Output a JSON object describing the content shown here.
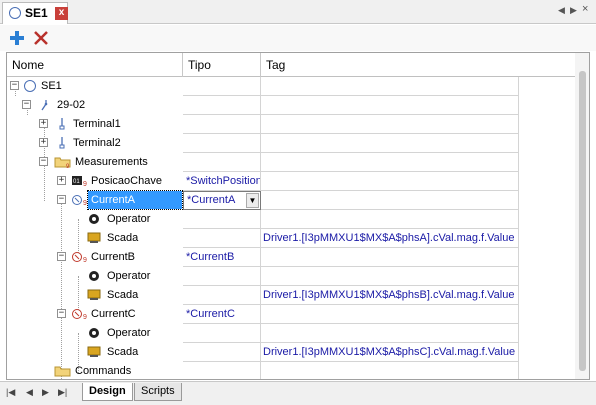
{
  "document_tab": {
    "title": "SE1",
    "close": "x"
  },
  "tab_nav": {
    "left": "◀",
    "right": "▶",
    "close": "×"
  },
  "toolbar": {
    "add": "+",
    "delete": "✕"
  },
  "columns": {
    "name": "Nome",
    "type": "Tipo",
    "tag": "Tag"
  },
  "rows": [
    {
      "label": "SE1",
      "type": "",
      "tag": "",
      "icon": "circle-icon",
      "expander": "−"
    },
    {
      "label": "29-02",
      "type": "",
      "tag": "",
      "icon": "bay-icon",
      "expander": "−"
    },
    {
      "label": "Terminal1",
      "type": "",
      "tag": "",
      "icon": "terminal-icon",
      "expander": "+"
    },
    {
      "label": "Terminal2",
      "type": "",
      "tag": "",
      "icon": "terminal-icon",
      "expander": "+"
    },
    {
      "label": "Measurements",
      "type": "",
      "tag": "",
      "icon": "folder-icon",
      "expander": "−"
    },
    {
      "label": "PosicaoChave",
      "type": "*SwitchPosition",
      "tag": "",
      "icon": "switch-position-icon",
      "expander": "+"
    },
    {
      "label": "CurrentA",
      "type": "*CurrentA",
      "tag": "",
      "icon": "current-icon",
      "expander": "−"
    },
    {
      "label": "Operator",
      "type": "",
      "tag": "",
      "icon": "operator-icon",
      "expander": ""
    },
    {
      "label": "Scada",
      "type": "",
      "tag": "Driver1.[I3pMMXU1$MX$A$phsA].cVal.mag.f.Value",
      "icon": "scada-icon",
      "expander": ""
    },
    {
      "label": "CurrentB",
      "type": "*CurrentB",
      "tag": "",
      "icon": "current-icon",
      "expander": "−"
    },
    {
      "label": "Operator",
      "type": "",
      "tag": "",
      "icon": "operator-icon",
      "expander": ""
    },
    {
      "label": "Scada",
      "type": "",
      "tag": "Driver1.[I3pMMXU1$MX$A$phsB].cVal.mag.f.Value",
      "icon": "scada-icon",
      "expander": ""
    },
    {
      "label": "CurrentC",
      "type": "*CurrentC",
      "tag": "",
      "icon": "current-icon",
      "expander": "−"
    },
    {
      "label": "Operator",
      "type": "",
      "tag": "",
      "icon": "operator-icon",
      "expander": ""
    },
    {
      "label": "Scada",
      "type": "",
      "tag": "Driver1.[I3pMMXU1$MX$A$phsC].cVal.mag.f.Value",
      "icon": "scada-icon",
      "expander": ""
    },
    {
      "label": "Commands",
      "type": "",
      "tag": "",
      "icon": "folder-icon",
      "expander": ""
    }
  ],
  "bottom_tabs": {
    "design": "Design",
    "scripts": "Scripts"
  },
  "bottom_nav": {
    "first": "|◀",
    "prev": "◀",
    "next": "▶",
    "last": "▶|"
  }
}
